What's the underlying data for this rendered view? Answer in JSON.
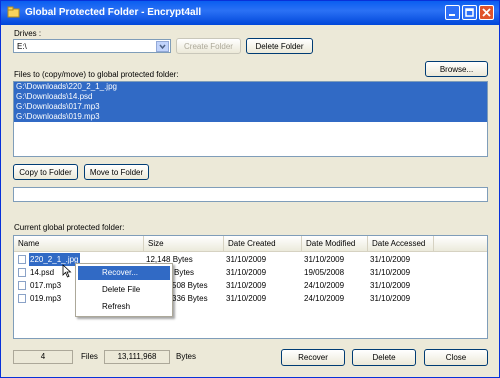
{
  "window": {
    "title": "Global Protected Folder - Encrypt4all",
    "buttons": {
      "minimize": "minimize",
      "maximize": "maximize",
      "close": "close"
    }
  },
  "drives": {
    "label": "Drives :",
    "selected": "E:\\",
    "create_folder": "Create Folder",
    "delete_folder": "Delete Folder"
  },
  "files_section": {
    "label": "Files to (copy/move) to global protected folder:",
    "browse": "Browse...",
    "items": [
      "G:\\Downloads\\220_2_1_.jpg",
      "G:\\Downloads\\14.psd",
      "G:\\Downloads\\017.mp3",
      "G:\\Downloads\\019.mp3"
    ],
    "copy_to_folder": "Copy to Folder",
    "move_to_folder": "Move to Folder",
    "progress": 0
  },
  "protected_folder": {
    "label": "Current global protected folder:",
    "columns": [
      "Name",
      "Size",
      "Date Created",
      "Date Modified",
      "Date Accessed"
    ],
    "rows": [
      {
        "name": "220_2_1_.jpg",
        "size": "12,148 Bytes",
        "created": "31/10/2009",
        "modified": "31/10/2009",
        "accessed": "31/10/2009"
      },
      {
        "name": "14.psd",
        "size": "Bytes",
        "created": "31/10/2009",
        "modified": "19/05/2008",
        "accessed": "31/10/2009"
      },
      {
        "name": "017.mp3",
        "size": "508 Bytes",
        "created": "31/10/2009",
        "modified": "24/10/2009",
        "accessed": "31/10/2009"
      },
      {
        "name": "019.mp3",
        "size": "336 Bytes",
        "created": "31/10/2009",
        "modified": "24/10/2009",
        "accessed": "31/10/2009"
      }
    ]
  },
  "context_menu": {
    "items": [
      "Recover...",
      "Delete File",
      "Refresh"
    ]
  },
  "status": {
    "file_count": "4",
    "files_label": "Files",
    "byte_count": "13,111,968",
    "bytes_label": "Bytes"
  },
  "actions": {
    "recover": "Recover",
    "delete": "Delete",
    "close": "Close"
  }
}
